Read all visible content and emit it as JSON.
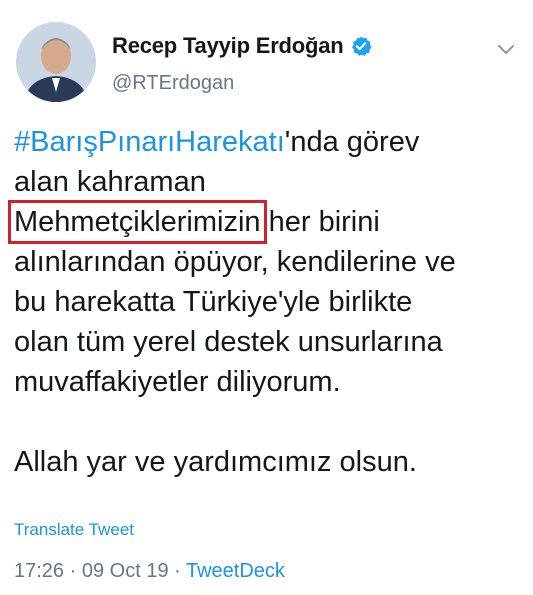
{
  "user": {
    "display_name": "Recep Tayyip Erdoğan",
    "handle": "@RTErdogan",
    "verified_icon": "verified-badge-icon",
    "menu_icon": "chevron-down-icon"
  },
  "tweet": {
    "hashtag": "#BarışPınarıHarekatı",
    "line1_rest": "'nda görev",
    "line2": "alan kahraman",
    "highlighted_word": "Mehmetçiklerimizin",
    "line3_rest": " her birini",
    "line4": "alınlarından öpüyor, kendilerine ve",
    "line5": "bu harekatta Türkiye'yle birlikte",
    "line6": "olan tüm yerel destek unsurlarına",
    "line7": "muvaffakiyetler diliyorum.",
    "line8": "Allah yar ve yardımcımız olsun.",
    "translate_label": "Translate Tweet",
    "time": "17:26",
    "date": "09 Oct 19",
    "separator": " · ",
    "source": "TweetDeck"
  },
  "colors": {
    "link": "#1b95e0",
    "text": "#14171a",
    "secondary": "#657786",
    "highlight_box": "#d0222b"
  }
}
